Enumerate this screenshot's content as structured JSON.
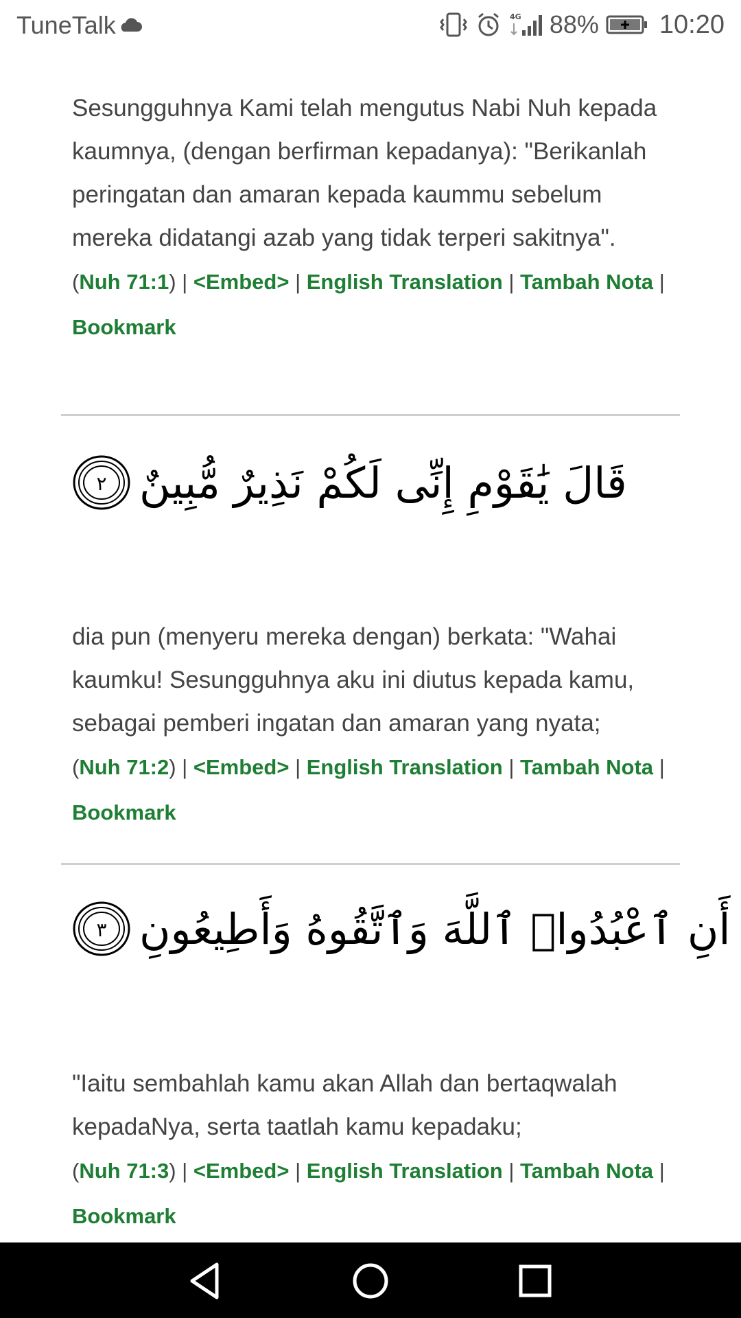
{
  "status_bar": {
    "carrier": "TuneTalk",
    "network": "4G",
    "battery": "88%",
    "time": "10:20",
    "icons": [
      "cloud-icon",
      "vibrate-icon",
      "alarm-icon",
      "signal-icon",
      "battery-charging-icon"
    ]
  },
  "verses": [
    {
      "translation": "Sesungguhnya Kami telah mengutus Nabi Nuh kepada kaumnya, (dengan berfirman kepadanya): \"Berikanlah peringatan dan amaran kepada kaummu sebelum mereka didatangi azab yang tidak terperi sakitnya\".",
      "ref": "Nuh 71:1"
    },
    {
      "arabic": "قَالَ يَٰقَوْمِ إِنِّى لَكُمْ نَذِيرٌ مُّبِينٌ",
      "number": "٢",
      "translation": "dia pun (menyeru mereka dengan) berkata: \"Wahai kaumku! Sesungguhnya aku ini diutus kepada kamu, sebagai pemberi ingatan dan amaran yang nyata;",
      "ref": "Nuh 71:2"
    },
    {
      "arabic": "أَنِ ٱعْبُدُوا۟ ٱللَّهَ وَٱتَّقُوهُ وَأَطِيعُونِ",
      "number": "٣",
      "translation": "\"Iaitu sembahlah kamu akan Allah dan bertaqwalah kepadaNya, serta taatlah kamu kepadaku;",
      "ref": "Nuh 71:3"
    }
  ],
  "links": {
    "open_paren": "(",
    "close_sep": ") |",
    "embed": "<Embed>",
    "sep": "|",
    "english": "English Translation",
    "nota": "Tambah Nota",
    "bookmark": "Bookmark"
  },
  "colors": {
    "link": "#1e7e34",
    "text": "#444444",
    "divider": "#cfcfcf",
    "navbar": "#000000"
  },
  "navigation": {
    "buttons": [
      "back-icon",
      "home-icon",
      "recents-icon"
    ]
  }
}
